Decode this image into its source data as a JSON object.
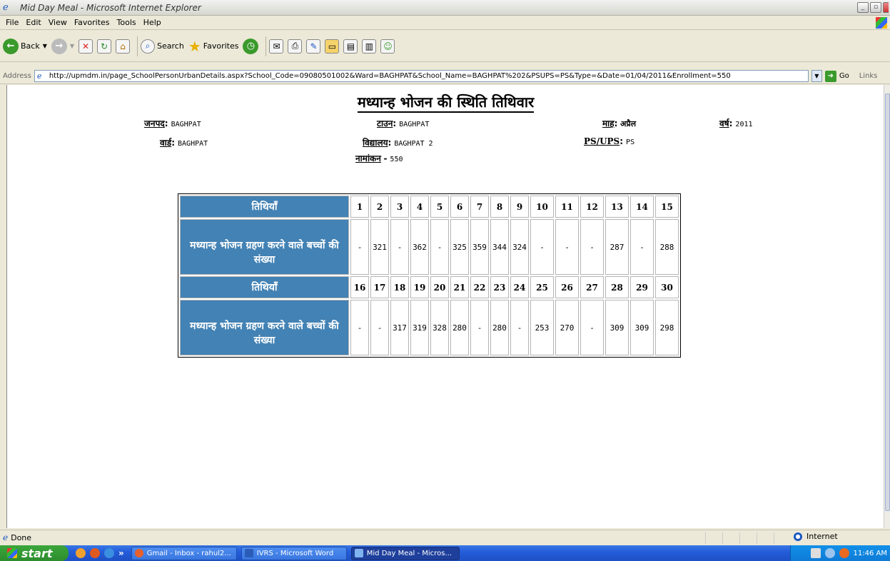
{
  "window": {
    "title": "Mid Day Meal - Microsoft Internet Explorer"
  },
  "menu": [
    "File",
    "Edit",
    "View",
    "Favorites",
    "Tools",
    "Help"
  ],
  "toolbar": {
    "back": "Back",
    "search": "Search",
    "favorites": "Favorites"
  },
  "address": {
    "label": "Address",
    "url": "http://upmdm.in/page_SchoolPersonUrbanDetails.aspx?School_Code=09080501002&Ward=BAGHPAT&School_Name=BAGHPAT%202&PSUPS=PS&Type=&Date=01/04/2011&Enrollment=550",
    "go": "Go",
    "links": "Links"
  },
  "page": {
    "heading": "मध्यान्ह भोजन की स्थिति तिथिवार",
    "district_label": "जनपद",
    "district": "BAGHPAT",
    "town_label": "टाउन",
    "town": "BAGHPAT",
    "month_label": "माह",
    "month": "अप्रैल",
    "year_label": "वर्ष",
    "year": "2011",
    "ward_label": "वार्ड",
    "ward": "BAGHPAT",
    "school_label": "विद्यालय",
    "school": "BAGHPAT 2",
    "psups_label": "PS/UPS",
    "psups": "PS",
    "enrollment_label": "नामांकन",
    "enrollment": "550"
  },
  "table": {
    "dates_header": "तिथियाँ",
    "count_header": "मध्यान्ह भोजन ग्रहण करने वाले बच्चों की संख्या",
    "block1": {
      "dates": [
        "1",
        "2",
        "3",
        "4",
        "5",
        "6",
        "7",
        "8",
        "9",
        "10",
        "11",
        "12",
        "13",
        "14",
        "15"
      ],
      "counts": [
        "-",
        "321",
        "-",
        "362",
        "-",
        "325",
        "359",
        "344",
        "324",
        "-",
        "-",
        "-",
        "287",
        "-",
        "288"
      ]
    },
    "block2": {
      "dates": [
        "16",
        "17",
        "18",
        "19",
        "20",
        "21",
        "22",
        "23",
        "24",
        "25",
        "26",
        "27",
        "28",
        "29",
        "30"
      ],
      "counts": [
        "-",
        "-",
        "317",
        "319",
        "328",
        "280",
        "-",
        "280",
        "-",
        "253",
        "270",
        "-",
        "309",
        "309",
        "298"
      ]
    }
  },
  "status": {
    "text": "Done",
    "zone": "Internet"
  },
  "taskbar": {
    "start": "start",
    "tasks": [
      "Gmail - Inbox - rahul2...",
      "IVRS - Microsoft Word",
      "Mid Day Meal - Micros..."
    ],
    "clock": "11:46 AM"
  }
}
